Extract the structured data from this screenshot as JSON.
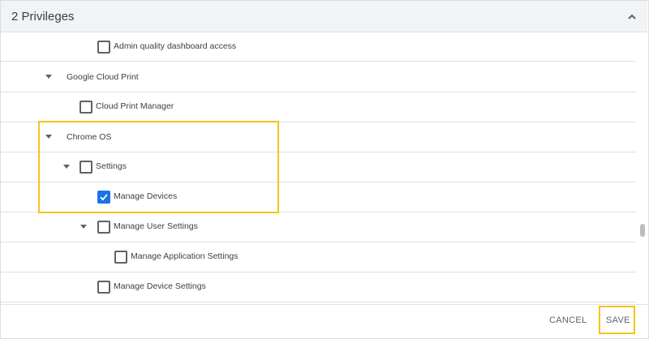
{
  "header": {
    "title": "2 Privileges",
    "collapse_icon": "chevron-up-icon"
  },
  "privileges": [
    {
      "label": "Admin quality dashboard access"
    },
    {
      "label": "Google Cloud Print"
    },
    {
      "label": "Cloud Print Manager"
    },
    {
      "label": "Chrome OS"
    },
    {
      "label": "Settings"
    },
    {
      "label": "Manage Devices",
      "checked": true
    },
    {
      "label": "Manage User Settings"
    },
    {
      "label": "Manage Application Settings"
    },
    {
      "label": "Manage Device Settings"
    }
  ],
  "footer": {
    "cancel_label": "CANCEL",
    "save_label": "SAVE"
  },
  "colors": {
    "highlight": "#f5c518",
    "checkbox_checked": "#1a73e8"
  }
}
